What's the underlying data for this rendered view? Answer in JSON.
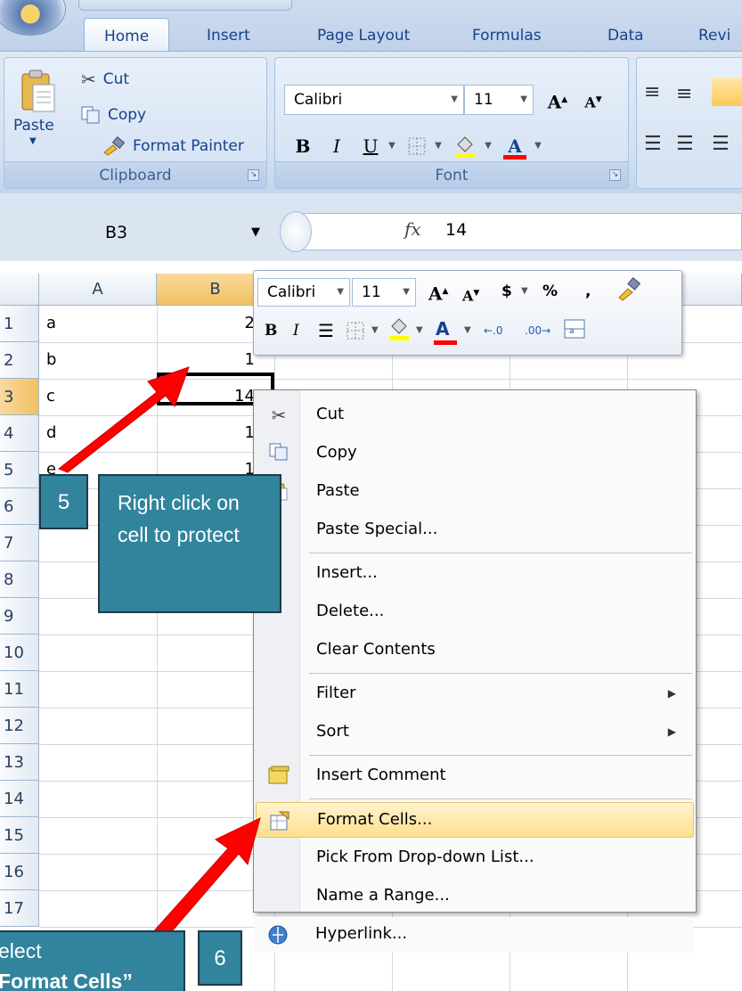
{
  "ribbon": {
    "tabs": [
      "Home",
      "Insert",
      "Page Layout",
      "Formulas",
      "Data",
      "Revi"
    ],
    "clipboard": {
      "paste_label": "Paste",
      "cut_label": "Cut",
      "copy_label": "Copy",
      "format_painter_label": "Format Painter",
      "group_label": "Clipboard"
    },
    "font": {
      "font_name": "Calibri",
      "font_size": "11",
      "group_label": "Font",
      "bold": "B",
      "italic": "I",
      "underline": "U",
      "grow": "A",
      "shrink": "A"
    }
  },
  "formula_bar": {
    "name_box": "B3",
    "fx": "fx",
    "value": "14"
  },
  "grid": {
    "columns": [
      "A",
      "B"
    ],
    "rows": [
      "1",
      "2",
      "3",
      "4",
      "5",
      "6",
      "7",
      "8",
      "9",
      "10",
      "11",
      "12",
      "13",
      "14",
      "15",
      "16",
      "17"
    ],
    "column_a": [
      "a",
      "b",
      "c",
      "d",
      "e"
    ],
    "column_b_visible": [
      "2",
      "1",
      "14",
      "1",
      "1"
    ]
  },
  "mini_toolbar": {
    "font_name": "Calibri",
    "font_size": "11",
    "currency": "$",
    "percent": "%",
    "comma": ",",
    "bold": "B",
    "italic": "I",
    "font_color": "A"
  },
  "context_menu": {
    "items": [
      {
        "label": "Cut",
        "icon": "scissors-icon"
      },
      {
        "label": "Copy",
        "icon": "copy-icon"
      },
      {
        "label": "Paste",
        "icon": "paste-icon"
      },
      {
        "label": "Paste Special...",
        "icon": ""
      },
      {
        "label": "Insert...",
        "icon": ""
      },
      {
        "label": "Delete...",
        "icon": ""
      },
      {
        "label": "Clear Contents",
        "icon": ""
      },
      {
        "label": "Filter",
        "icon": ""
      },
      {
        "label": "Sort",
        "icon": ""
      },
      {
        "label": "Insert Comment",
        "icon": "comment-icon"
      },
      {
        "label": "Format Cells...",
        "icon": "format-cells-icon"
      },
      {
        "label": "Pick From Drop-down List...",
        "icon": ""
      },
      {
        "label": "Name a Range...",
        "icon": ""
      },
      {
        "label": "Hyperlink...",
        "icon": "hyperlink-icon"
      }
    ]
  },
  "annotations": {
    "step5_number": "5",
    "step5_text": "Right click on cell to protect",
    "step6_number": "6",
    "step6_line1": "elect",
    "step6_line2": "Format Cells”"
  },
  "colors": {
    "callout_bg": "#31849b",
    "arrow_red": "#ff0000",
    "hover_highlight": "#fedf8e",
    "selected_header": "#f1c15f"
  }
}
